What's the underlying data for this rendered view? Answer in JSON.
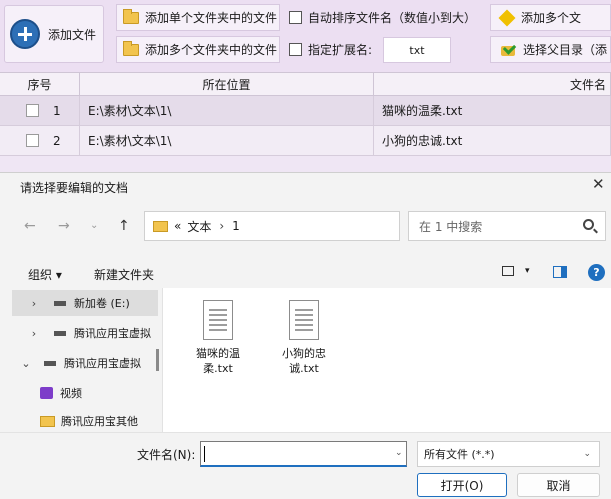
{
  "toolbar": {
    "add_file_label": "添加文件",
    "add_single_folder_label": "添加单个文件夹中的文件",
    "add_multi_folder_label": "添加多个文件夹中的文件",
    "auto_sort_label": "自动排序文件名（数值小到大）",
    "ext_label": "指定扩展名:",
    "ext_value": "txt",
    "add_multi_right_label": "添加多个文",
    "select_parent_label": "选择父目录（添"
  },
  "table": {
    "headers": [
      "序号",
      "所在位置",
      "文件名"
    ],
    "rows": [
      {
        "index": "1",
        "location": "E:\\素材\\文本\\1\\",
        "name": "猫咪的温柔.txt"
      },
      {
        "index": "2",
        "location": "E:\\素材\\文本\\1\\",
        "name": "小狗的忠诚.txt"
      }
    ]
  },
  "dialog": {
    "title": "请选择要编辑的文档",
    "path": {
      "prefix": "«",
      "segments": [
        "文本",
        "1"
      ]
    },
    "search_placeholder": "在 1 中搜索",
    "organize_label": "组织 ▾",
    "new_folder_label": "新建文件夹",
    "nav_items": [
      {
        "label": "新加卷 (E:)",
        "selected": true
      },
      {
        "label": "腾讯应用宝虚拟",
        "selected": false
      },
      {
        "label": "腾讯应用宝虚拟",
        "selected": false
      },
      {
        "label": "视频",
        "selected": false
      },
      {
        "label": "腾讯应用宝其他",
        "selected": false
      }
    ],
    "files": [
      {
        "label": "猫咪的温柔.txt"
      },
      {
        "label": "小狗的忠诚.txt"
      }
    ],
    "filename_label": "文件名(N):",
    "filename_value": "",
    "filetype_value": "所有文件 (*.*)",
    "open_label": "打开(O)",
    "cancel_label": "取消"
  }
}
